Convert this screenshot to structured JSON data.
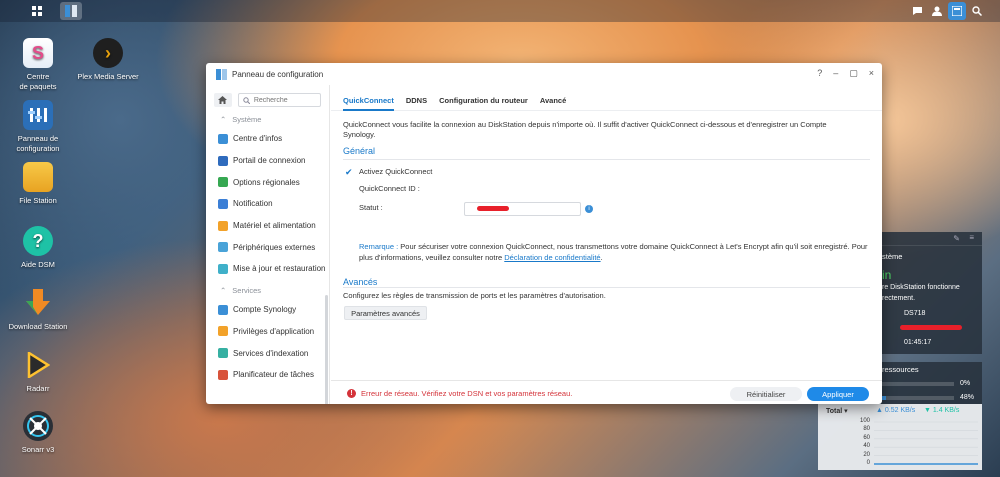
{
  "desktop": {
    "icons": [
      {
        "label": "Centre\nde paquets",
        "name": "package-center"
      },
      {
        "label": "Plex Media Server",
        "name": "plex"
      },
      {
        "label": "Panneau de\nconfiguration",
        "name": "control-panel"
      },
      {
        "label": "File Station",
        "name": "file-station"
      },
      {
        "label": "Aide DSM",
        "name": "dsm-help"
      },
      {
        "label": "Download Station",
        "name": "download-station"
      },
      {
        "label": "Radarr",
        "name": "radarr"
      },
      {
        "label": "Sonarr v3",
        "name": "sonarr"
      }
    ]
  },
  "window": {
    "title": "Panneau de configuration",
    "controls": {
      "help": "?",
      "minimize": "–",
      "maximize": "▢",
      "close": "×"
    }
  },
  "sidebar": {
    "search_placeholder": "Recherche",
    "section_system": "Système",
    "system_items": [
      {
        "label": "Centre d'infos",
        "color": "#3b8fd6"
      },
      {
        "label": "Portail de connexion",
        "color": "#2f6bbd"
      },
      {
        "label": "Options régionales",
        "color": "#36a852"
      },
      {
        "label": "Notification",
        "color": "#3b7fd6"
      },
      {
        "label": "Matériel et alimentation",
        "color": "#f2a22a"
      },
      {
        "label": "Périphériques externes",
        "color": "#4aa3d8"
      },
      {
        "label": "Mise à jour et restauration",
        "color": "#3fb0c9"
      }
    ],
    "section_services": "Services",
    "service_items": [
      {
        "label": "Compte Synology",
        "color": "#3b8fd6"
      },
      {
        "label": "Privilèges d'application",
        "color": "#f2a22a"
      },
      {
        "label": "Services d'indexation",
        "color": "#36b0a2"
      },
      {
        "label": "Planificateur de tâches",
        "color": "#d8533b"
      }
    ]
  },
  "tabs": [
    "QuickConnect",
    "DDNS",
    "Configuration du routeur",
    "Avancé"
  ],
  "content": {
    "intro": "QuickConnect vous facilite la connexion au DiskStation depuis n'importe où. Il suffit d'activer QuickConnect ci-dessous et d'enregistrer un Compte Synology.",
    "general_title": "Général",
    "enable_label": "Activez QuickConnect",
    "qc_id_label": "QuickConnect ID :",
    "qc_id_value": "",
    "status_label": "Statut :",
    "remark_prefix": "Remarque :",
    "remark_text": " Pour sécuriser votre connexion QuickConnect, nous transmettons votre domaine QuickConnect à Let's Encrypt afin qu'il soit enregistré. Pour plus d'informations, veuillez consulter notre ",
    "remark_link": "Déclaration de confidentialité",
    "remark_end": ".",
    "advanced_title": "Avancés",
    "advanced_desc": "Configurez les règles de transmission de ports et les paramètres d'autorisation.",
    "advanced_button": "Paramètres avancés"
  },
  "footer": {
    "error": "Erreur de réseau. Vérifiez votre DSN et vos paramètres réseau.",
    "reset": "Réinitialiser",
    "apply": "Appliquer"
  },
  "system_widget": {
    "title_fragment": "stème",
    "status_fragment": "in",
    "line1": "re DiskStation fonctionne",
    "line2": "rectement.",
    "model": "DS718",
    "uptime": "01:45:17"
  },
  "resource_widget": {
    "title_fragment": "ressources",
    "cpu_pct": "0%",
    "ram_pct": "48%",
    "ram_fill": 0.48,
    "total_label": "Total ▾",
    "upload": "0.52 KB/s",
    "download": "1.4 KB/s",
    "y_ticks": [
      "100",
      "80",
      "60",
      "40",
      "20",
      "0"
    ]
  }
}
